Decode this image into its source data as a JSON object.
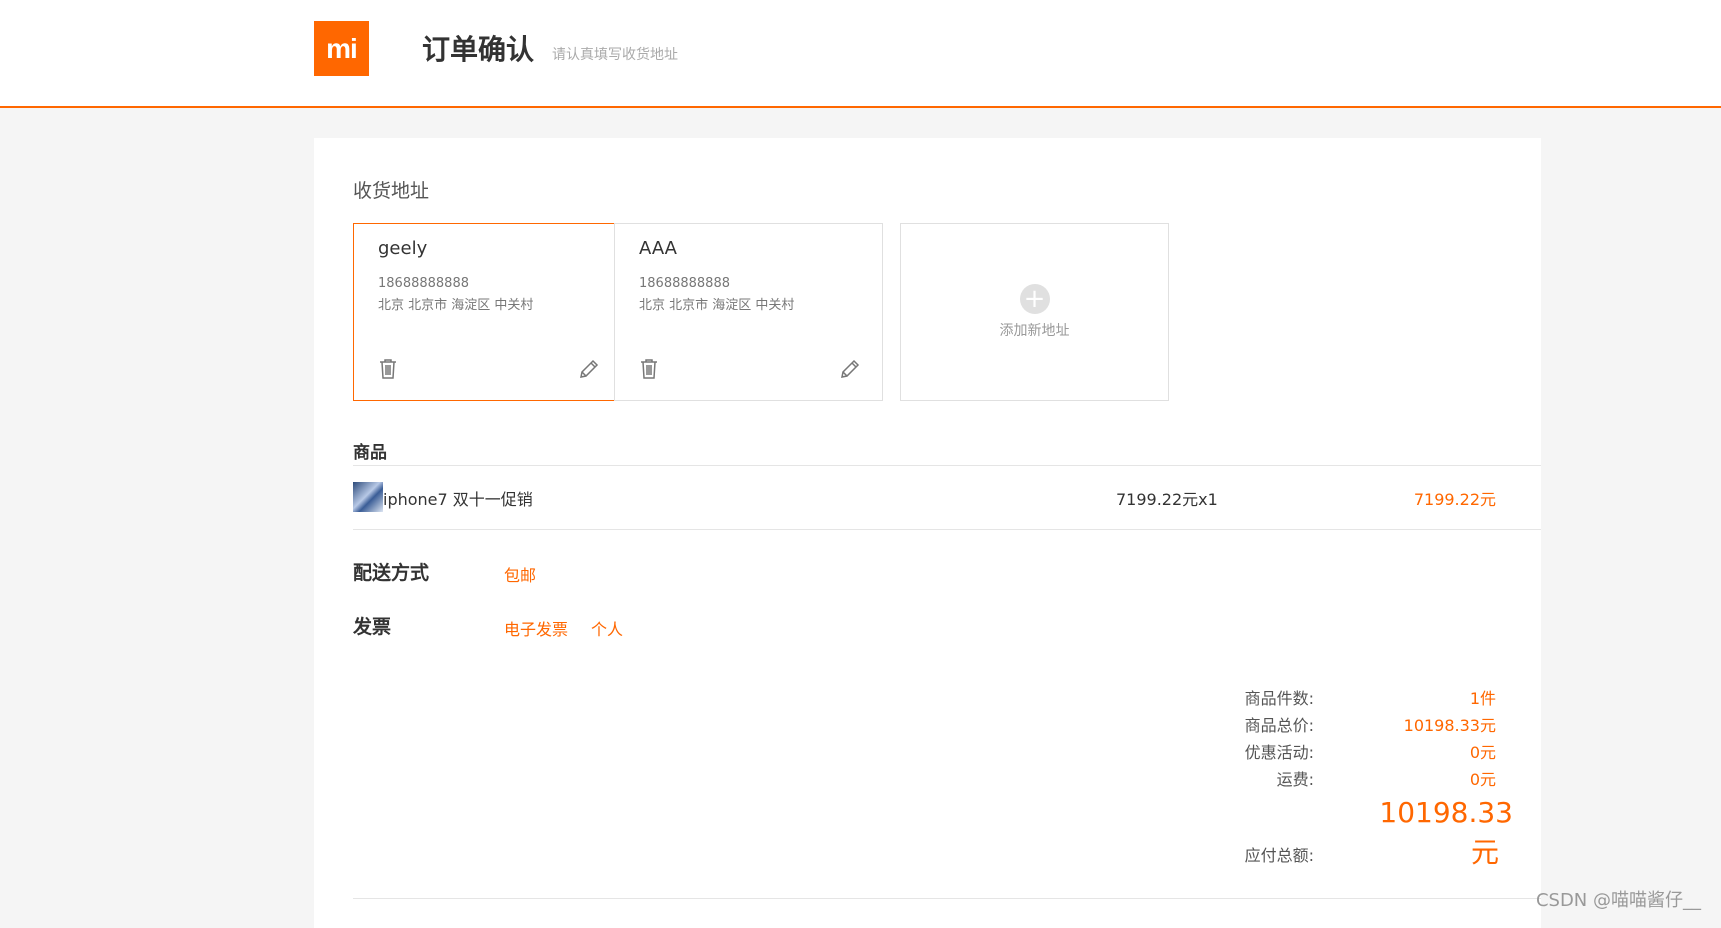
{
  "header": {
    "logo_text": "mi",
    "title": "订单确认",
    "subtitle": "请认真填写收货地址",
    "accent_color": "#ff6700"
  },
  "address_section": {
    "title": "收货地址",
    "addresses": [
      {
        "name": "geely",
        "phone": "18688888888",
        "place": "北京 北京市 海淀区 中关村",
        "selected": true
      },
      {
        "name": "AAA",
        "phone": "18688888888",
        "place": "北京 北京市 海淀区 中关村",
        "selected": false
      }
    ],
    "add_label": "添加新地址",
    "add_icon": "plus-icon"
  },
  "goods_section": {
    "title": "商品",
    "items": [
      {
        "name": "iphone7 双十一促销",
        "price_qty": "7199.22元x1",
        "subtotal": "7199.22元"
      }
    ]
  },
  "delivery": {
    "label": "配送方式",
    "value": "包邮"
  },
  "invoice": {
    "label": "发票",
    "type": "电子发票",
    "title": "个人"
  },
  "summary": {
    "count_label": "商品件数:",
    "count_value": "1件",
    "total_label": "商品总价:",
    "total_value": "10198.33元",
    "discount_label": "优惠活动:",
    "discount_value": "0元",
    "shipping_label": "运费:",
    "shipping_value": "0元",
    "payable_label": "应付总额:",
    "payable_amount": "10198.33",
    "payable_unit": "元"
  },
  "watermark": "CSDN @喵喵酱仔__"
}
